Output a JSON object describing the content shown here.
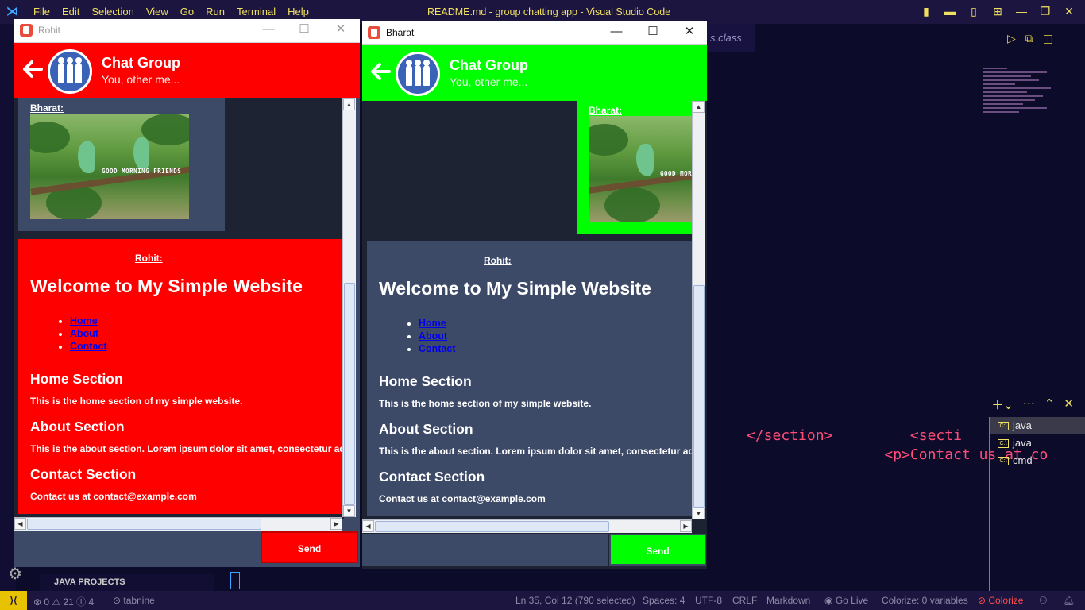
{
  "vscode": {
    "menu": [
      "File",
      "Edit",
      "Selection",
      "View",
      "Go",
      "Run",
      "Terminal",
      "Help"
    ],
    "window_title": "README.md - group chatting app - Visual Studio Code",
    "tab_fragment": "s.class",
    "terminal_lines": [
      "</section>         <secti",
      "                <p>Contact us at co"
    ],
    "terminal_list": [
      "java",
      "java",
      "cmd"
    ],
    "java_projects": "JAVA PROJECTS",
    "status": {
      "problems": "⊗ 0 ⚠ 21 ⓘ 4",
      "tabnine": "tabnine",
      "position": "Ln 35, Col 12 (790 selected)",
      "spaces": "Spaces: 4",
      "encoding": "UTF-8",
      "eol": "CRLF",
      "language": "Markdown",
      "golive": "Go Live",
      "colorize_vars": "Colorize: 0 variables",
      "colorize": "Colorize"
    }
  },
  "left_window": {
    "title": "Rohit",
    "header_color": "#ff0000",
    "group_name": "Chat Group",
    "group_members": "You, other me...",
    "image_message": {
      "sender": "Bharat:",
      "photo_caption": "GOOD MORNING FRIENDS",
      "bubble_color": "#3d4a67"
    },
    "html_message": {
      "sender": "Rohit:",
      "bubble_color": "#ff0000",
      "heading": "Welcome to My Simple Website",
      "nav": [
        "Home",
        "About",
        "Contact"
      ],
      "sections": [
        {
          "title": "Home Section",
          "text": "This is the home section of my simple website."
        },
        {
          "title": "About Section",
          "text": "This is the about section. Lorem ipsum dolor sit amet, consectetur adi"
        },
        {
          "title": "Contact Section",
          "text": "Contact us at contact@example.com"
        }
      ]
    },
    "send_label": "Send",
    "send_color": "#ff0000"
  },
  "right_window": {
    "title": "Bharat",
    "header_color": "#00ff00",
    "group_name": "Chat Group",
    "group_members": "You, other me...",
    "image_message": {
      "sender": "Bharat:",
      "photo_caption": "GOOD MORN",
      "bubble_color": "#00ff00"
    },
    "html_message": {
      "sender": "Rohit:",
      "bubble_color": "#3d4a67",
      "heading": "Welcome to My Simple Website",
      "nav": [
        "Home",
        "About",
        "Contact"
      ],
      "sections": [
        {
          "title": "Home Section",
          "text": "This is the home section of my simple website."
        },
        {
          "title": "About Section",
          "text": "This is the about section. Lorem ipsum dolor sit amet, consectetur adi"
        },
        {
          "title": "Contact Section",
          "text": "Contact us at contact@example.com"
        }
      ]
    },
    "send_label": "Send",
    "send_color": "#00ff00"
  }
}
